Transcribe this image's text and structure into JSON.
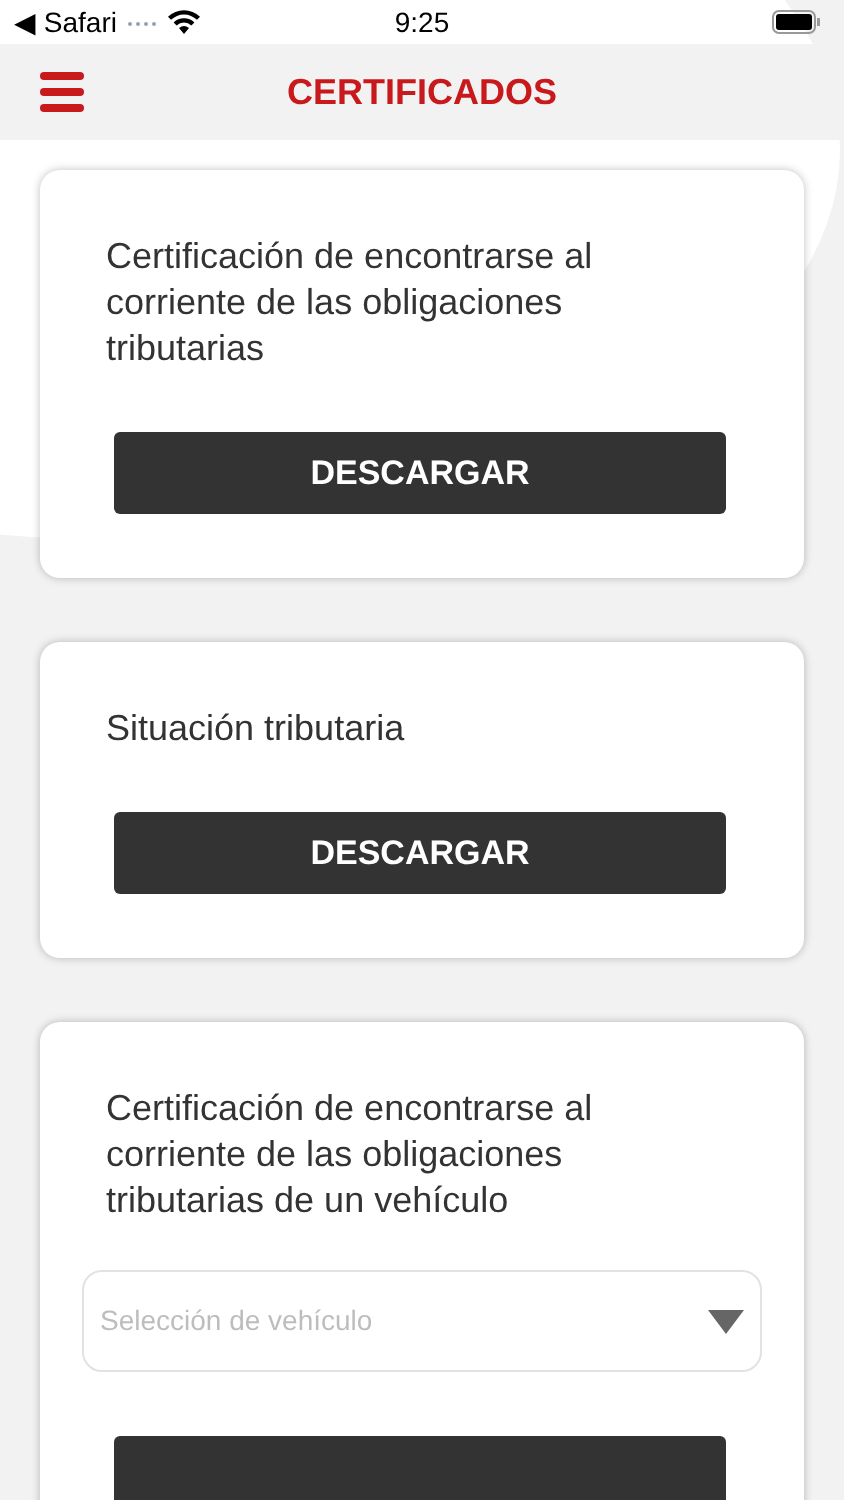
{
  "status_bar": {
    "back_app": "◀ Safari",
    "time": "9:25"
  },
  "header": {
    "title": "CERTIFICADOS"
  },
  "cards": [
    {
      "kind": "button",
      "title": "Certificación de encontrarse al corriente de las obligaciones tributarias",
      "button": "DESCARGAR"
    },
    {
      "kind": "button",
      "title": "Situación tributaria",
      "button": "DESCARGAR"
    },
    {
      "kind": "select",
      "title": "Certificación de encontrarse al corriente de las obligaciones tributarias de un vehículo",
      "select": {
        "placeholder": "Selección de vehículo"
      }
    }
  ]
}
